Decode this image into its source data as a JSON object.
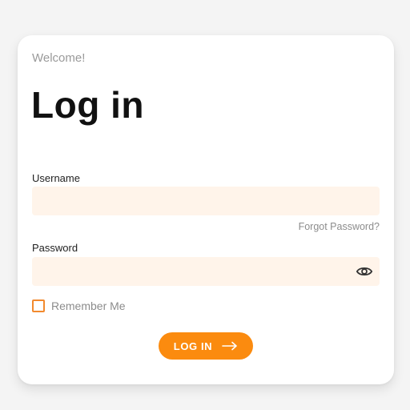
{
  "header": {
    "welcome": "Welcome!",
    "title": "Log in"
  },
  "form": {
    "username_label": "Username",
    "username_value": "",
    "username_placeholder": "",
    "forgot_password": "Forgot Password?",
    "password_label": "Password",
    "password_value": "",
    "password_placeholder": "",
    "remember_me": "Remember Me",
    "remember_checked": false,
    "login_button": "LOG IN"
  },
  "icons": {
    "password_toggle": "eye-icon",
    "button_arrow": "arrow-right-icon"
  },
  "colors": {
    "accent": "#fb8b0f",
    "input_background": "#fff4ea",
    "checkbox_border": "#f28a2e"
  }
}
